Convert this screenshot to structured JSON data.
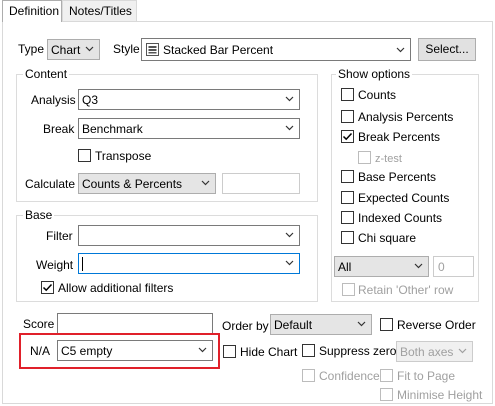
{
  "tabs": [
    {
      "label": "Definition",
      "active": true
    },
    {
      "label": "Notes/Titles",
      "active": false
    }
  ],
  "type": {
    "label": "Type",
    "value": "Chart"
  },
  "style": {
    "label": "Style",
    "value": "Stacked Bar Percent",
    "icon": "chart-icon"
  },
  "select_button": {
    "label": "Select..."
  },
  "content": {
    "title": "Content",
    "analysis": {
      "label": "Analysis",
      "value": "Q3"
    },
    "break": {
      "label": "Break",
      "value": "Benchmark"
    },
    "transpose": {
      "label": "Transpose",
      "checked": false
    },
    "calculate": {
      "label": "Calculate",
      "value": "Counts & Percents",
      "extra": ""
    }
  },
  "base": {
    "title": "Base",
    "filter": {
      "label": "Filter",
      "value": ""
    },
    "weight": {
      "label": "Weight",
      "value": ""
    },
    "allow_filters": {
      "label": "Allow additional filters",
      "checked": true
    }
  },
  "show_options": {
    "title": "Show options",
    "counts": {
      "label": "Counts",
      "checked": false
    },
    "analysis_percents": {
      "label": "Analysis Percents",
      "checked": false
    },
    "break_percents": {
      "label": "Break Percents",
      "checked": true
    },
    "ztest": {
      "label": "z-test",
      "checked": false,
      "disabled": true
    },
    "base_percents": {
      "label": "Base Percents",
      "checked": false
    },
    "expected_counts": {
      "label": "Expected Counts",
      "checked": false
    },
    "indexed_counts": {
      "label": "Indexed Counts",
      "checked": false
    },
    "chi_square": {
      "label": "Chi square",
      "checked": false
    },
    "all_select": {
      "value": "All"
    },
    "all_number": "0",
    "retain_other": {
      "label": "Retain 'Other' row",
      "checked": false,
      "disabled": true
    }
  },
  "score": {
    "label": "Score",
    "value": ""
  },
  "order_by": {
    "label": "Order by",
    "value": "Default"
  },
  "reverse_order": {
    "label": "Reverse Order",
    "checked": false
  },
  "na": {
    "label": "N/A",
    "value": "C5 empty"
  },
  "hide_chart": {
    "label": "Hide Chart",
    "checked": false
  },
  "suppress_zero": {
    "label": "Suppress zero",
    "checked": false
  },
  "axes": {
    "value": "Both axes"
  },
  "confidence": {
    "label": "Confidence",
    "checked": false
  },
  "fit_to_page": {
    "label": "Fit to Page",
    "checked": false
  },
  "minimise_height": {
    "label": "Minimise Height",
    "checked": false
  },
  "colors": {
    "highlight": "#e0202a"
  }
}
